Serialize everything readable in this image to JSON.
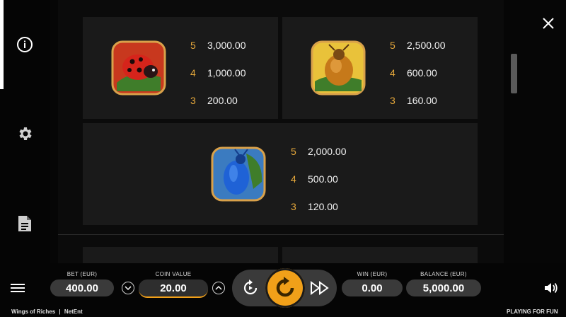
{
  "paytable": {
    "cards": [
      {
        "symbol_icon": "ladybug-icon",
        "rows": [
          {
            "count": "5",
            "value": "3,000.00"
          },
          {
            "count": "4",
            "value": "1,000.00"
          },
          {
            "count": "3",
            "value": "200.00"
          }
        ]
      },
      {
        "symbol_icon": "golden-beetle-icon",
        "rows": [
          {
            "count": "5",
            "value": "2,500.00"
          },
          {
            "count": "4",
            "value": "600.00"
          },
          {
            "count": "3",
            "value": "160.00"
          }
        ]
      },
      {
        "symbol_icon": "blue-beetle-icon",
        "rows": [
          {
            "count": "5",
            "value": "2,000.00"
          },
          {
            "count": "4",
            "value": "500.00"
          },
          {
            "count": "3",
            "value": "120.00"
          }
        ]
      }
    ]
  },
  "sidebar": {
    "items": [
      {
        "icon": "info-icon"
      },
      {
        "icon": "gear-icon"
      },
      {
        "icon": "document-icon"
      }
    ]
  },
  "bottom_bar": {
    "bet": {
      "label": "BET (EUR)",
      "value": "400.00"
    },
    "coin_value": {
      "label": "COIN VALUE",
      "value": "20.00"
    },
    "win": {
      "label": "WIN (EUR)",
      "value": "0.00"
    },
    "balance": {
      "label": "BALANCE (EUR)",
      "value": "5,000.00"
    }
  },
  "footer": {
    "game_name": "Wings of Riches",
    "separator": "|",
    "provider": "NetEnt",
    "mode": "PLAYING FOR FUN"
  },
  "colors": {
    "accent": "#f1a019",
    "multiplier": "#e6a83b",
    "card_bg": "#1a1a1a"
  }
}
